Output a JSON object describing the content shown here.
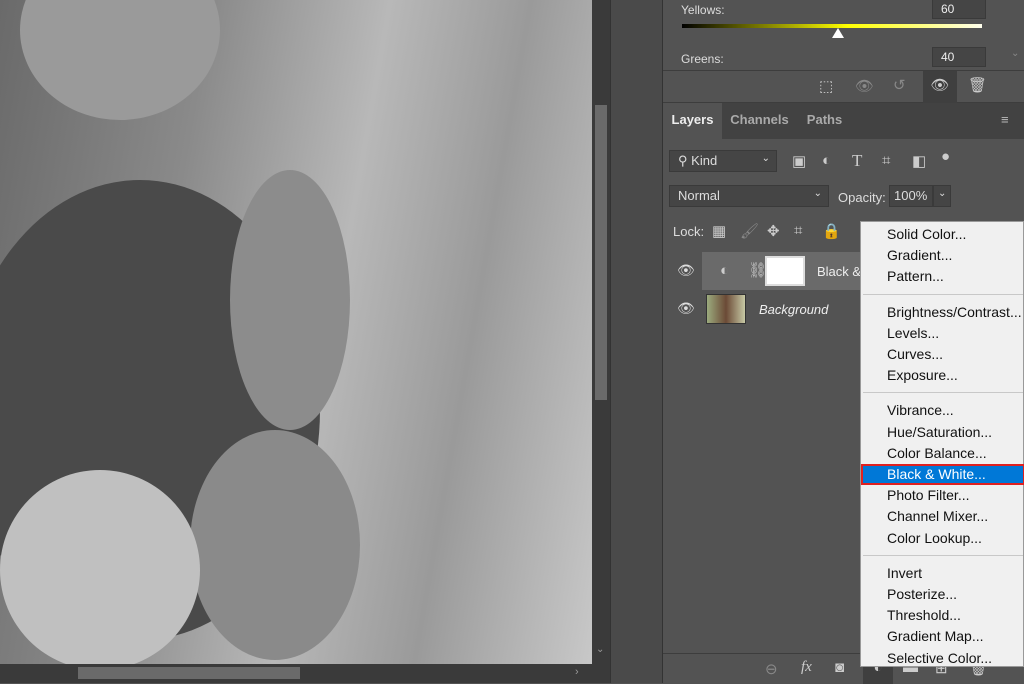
{
  "properties": {
    "yellows_label": "Yellows:",
    "yellows_value": "60",
    "greens_label": "Greens:",
    "greens_value": "40"
  },
  "tabs": [
    {
      "label": "Layers"
    },
    {
      "label": "Channels"
    },
    {
      "label": "Paths"
    }
  ],
  "filter": {
    "kind_label": "Kind"
  },
  "blend": {
    "mode": "Normal",
    "opacity_label": "Opacity:",
    "opacity_value": "100%"
  },
  "lock": {
    "label": "Lock:"
  },
  "layers": [
    {
      "name": "Black & White 1",
      "display": "Black &"
    },
    {
      "name": "Background"
    }
  ],
  "menu": {
    "groups": [
      [
        "Solid Color...",
        "Gradient...",
        "Pattern..."
      ],
      [
        "Brightness/Contrast...",
        "Levels...",
        "Curves...",
        "Exposure..."
      ],
      [
        "Vibrance...",
        "Hue/Saturation...",
        "Color Balance...",
        "Black & White...",
        "Photo Filter...",
        "Channel Mixer...",
        "Color Lookup..."
      ],
      [
        "Invert",
        "Posterize...",
        "Threshold...",
        "Gradient Map...",
        "Selective Color..."
      ]
    ],
    "selected": "Black & White..."
  },
  "bottom": {
    "fx_label": "fx"
  }
}
